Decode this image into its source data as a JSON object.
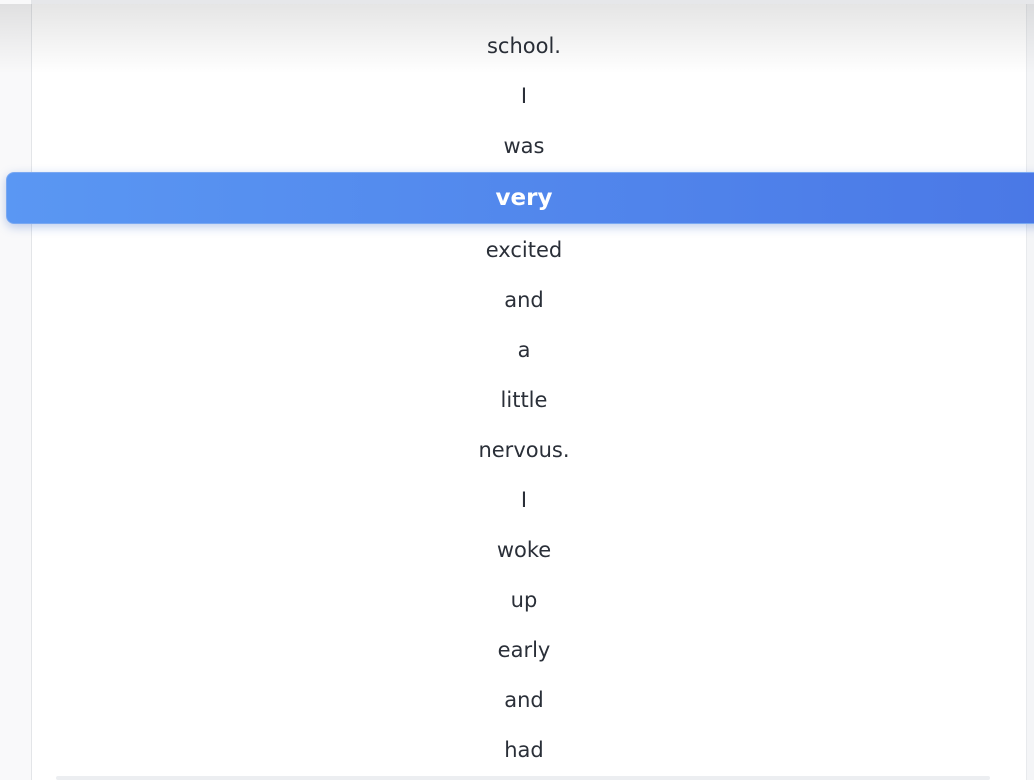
{
  "reader": {
    "words": [
      "school.",
      "I",
      "was",
      "very",
      "excited",
      "and",
      "a",
      "little",
      "nervous.",
      "I",
      "woke",
      "up",
      "early",
      "and",
      "had"
    ],
    "current_word": "very",
    "highlight_color_start": "#5a97f3",
    "highlight_color_end": "#4a78e6"
  }
}
